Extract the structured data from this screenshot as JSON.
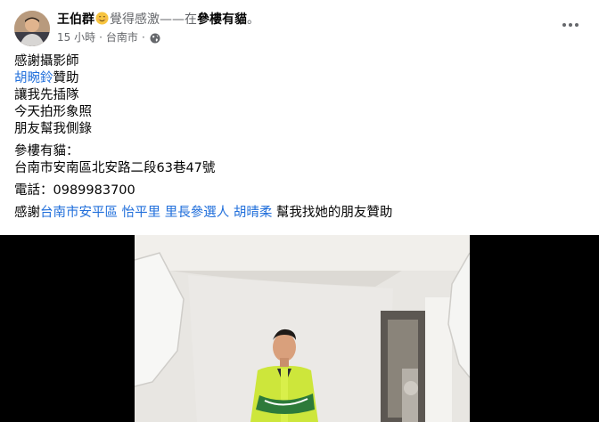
{
  "post": {
    "author": "王伯群",
    "feeling_text": "覺得感激——在",
    "place": "參樓有貓",
    "period": "。",
    "time": "15 小時",
    "separator": "·",
    "location": "台南市",
    "privacy_icon": "globe-icon",
    "menu_icon": "more-icon",
    "feeling_icon": "grateful-emoji-icon"
  },
  "body": {
    "line1": "感謝攝影師",
    "mention_photographer": "胡畹鈴",
    "line2_suffix": "贊助",
    "line3": "讓我先插隊",
    "line4": "今天拍形象照",
    "line5": "朋友幫我側錄",
    "shop_label": "參樓有貓：",
    "address": "台南市安南區北安路二段63巷47號",
    "phone": "電話：0989983700",
    "thanks_prefix": "感謝",
    "mention_candidate": "台南市安平區 怡平里 里長參選人 胡晴柔",
    "thanks_suffix": " 幫我找她的朋友贊助"
  },
  "colors": {
    "link": "#216fdb",
    "secondary_text": "#65676b",
    "primary_text": "#050505"
  }
}
